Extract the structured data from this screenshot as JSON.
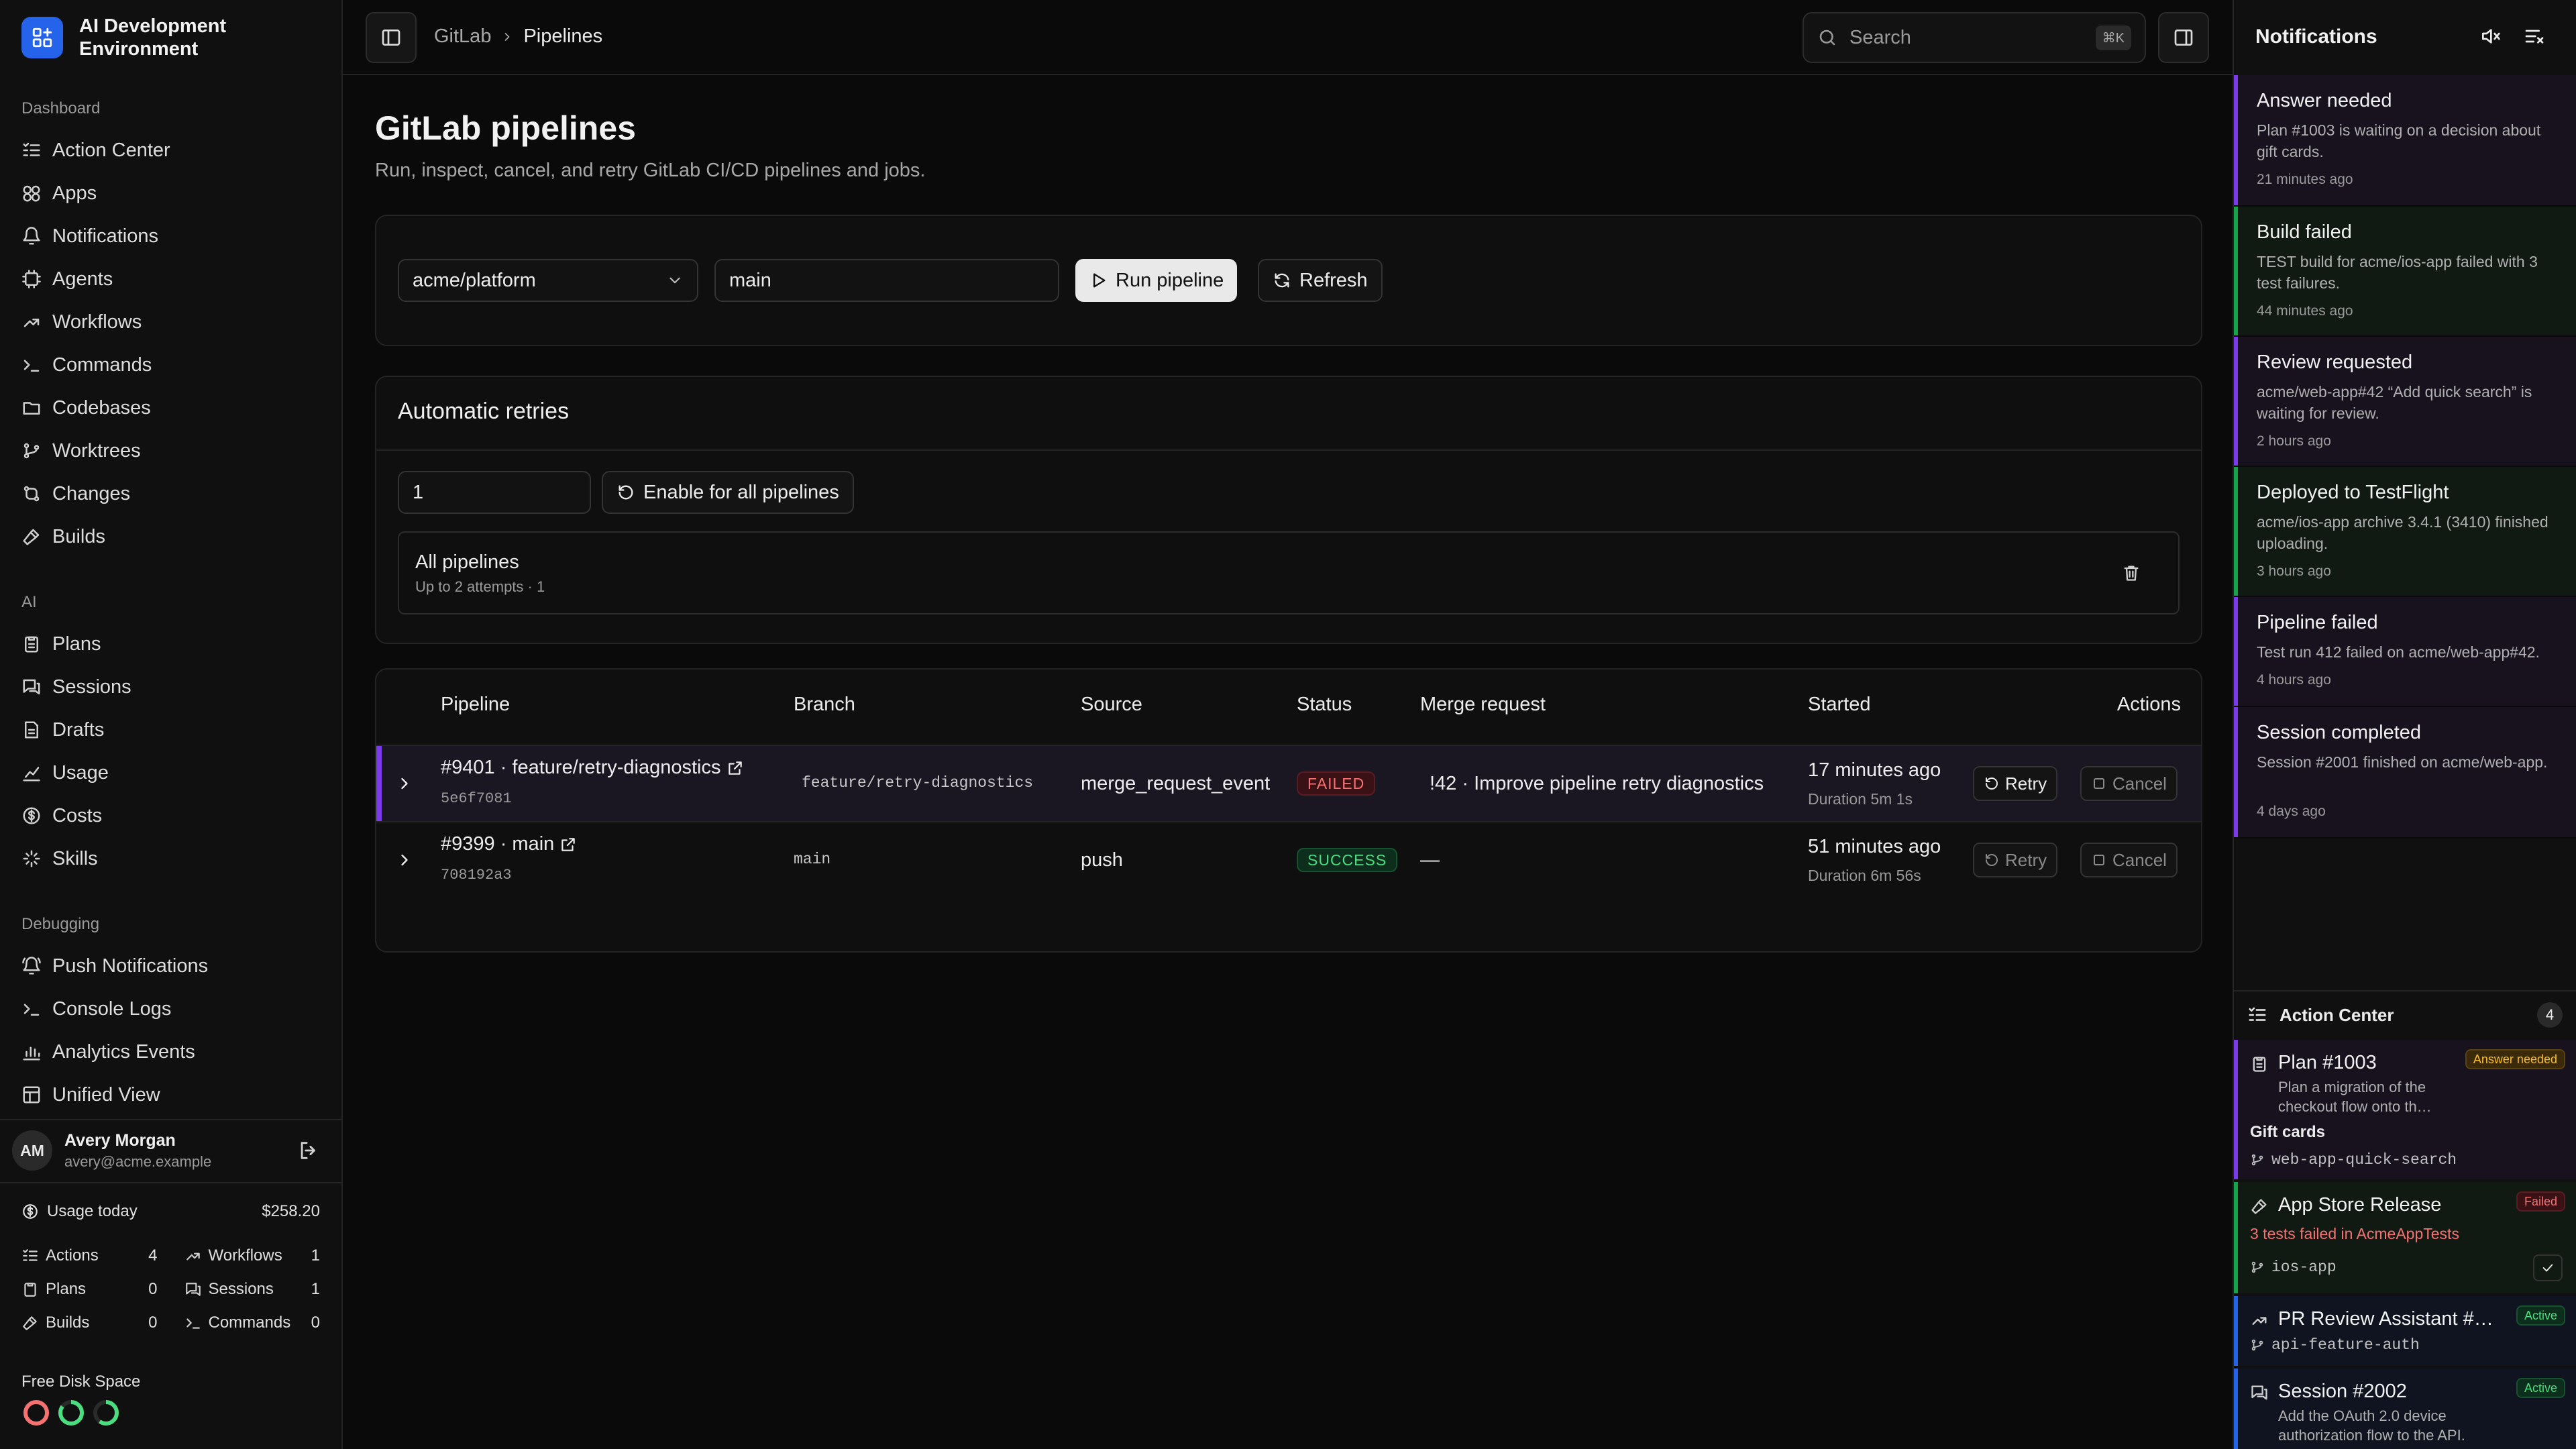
{
  "app": {
    "name": "AI Development Environment"
  },
  "sidebar": {
    "sections": [
      {
        "label": "Dashboard",
        "items": [
          {
            "label": "Action Center",
            "icon": "list-check-icon"
          },
          {
            "label": "Apps",
            "icon": "apps-icon"
          },
          {
            "label": "Notifications",
            "icon": "bell-icon"
          },
          {
            "label": "Agents",
            "icon": "agent-icon"
          },
          {
            "label": "Workflows",
            "icon": "workflow-icon"
          },
          {
            "label": "Commands",
            "icon": "terminal-icon"
          },
          {
            "label": "Codebases",
            "icon": "folder-icon"
          },
          {
            "label": "Worktrees",
            "icon": "git-branch-icon"
          },
          {
            "label": "Changes",
            "icon": "git-compare-icon"
          },
          {
            "label": "Builds",
            "icon": "hammer-icon"
          }
        ]
      },
      {
        "label": "AI",
        "items": [
          {
            "label": "Plans",
            "icon": "clipboard-icon"
          },
          {
            "label": "Sessions",
            "icon": "chat-icon"
          },
          {
            "label": "Drafts",
            "icon": "draft-icon"
          },
          {
            "label": "Usage",
            "icon": "chart-icon"
          },
          {
            "label": "Costs",
            "icon": "dollar-icon"
          },
          {
            "label": "Skills",
            "icon": "sparkle-icon"
          }
        ]
      },
      {
        "label": "Debugging",
        "items": [
          {
            "label": "Push Notifications",
            "icon": "bell-ring-icon"
          },
          {
            "label": "Console Logs",
            "icon": "terminal-icon"
          },
          {
            "label": "Analytics Events",
            "icon": "activity-icon"
          },
          {
            "label": "Unified View",
            "icon": "layout-icon"
          }
        ]
      }
    ],
    "user": {
      "initials": "AM",
      "name": "Avery Morgan",
      "email": "avery@acme.example"
    },
    "usage": {
      "label": "Usage today",
      "value": "$258.20",
      "stats": [
        {
          "label": "Actions",
          "value": "4",
          "icon": "list-check-icon"
        },
        {
          "label": "Workflows",
          "value": "1",
          "icon": "workflow-icon"
        },
        {
          "label": "Plans",
          "value": "0",
          "icon": "clipboard-icon"
        },
        {
          "label": "Sessions",
          "value": "1",
          "icon": "chat-icon"
        },
        {
          "label": "Builds",
          "value": "0",
          "icon": "hammer-icon"
        },
        {
          "label": "Commands",
          "value": "0",
          "icon": "terminal-icon"
        }
      ]
    },
    "disk": {
      "label": "Free Disk Space",
      "rings": [
        {
          "color": "#f87171",
          "fraction": 1.0
        },
        {
          "color": "#4ade80",
          "fraction": 0.85
        },
        {
          "color": "#4ade80",
          "fraction": 0.6
        }
      ]
    }
  },
  "topbar": {
    "breadcrumb": [
      "GitLab",
      "Pipelines"
    ],
    "search": {
      "placeholder": "Search",
      "shortcut": "⌘K"
    }
  },
  "page": {
    "title": "GitLab pipelines",
    "subtitle": "Run, inspect, cancel, and retry GitLab CI/CD pipelines and jobs.",
    "run": {
      "project": "acme/platform",
      "ref": "main",
      "run_label": "Run pipeline",
      "refresh_label": "Refresh"
    },
    "retries": {
      "title": "Automatic retries",
      "attempts_value": "1",
      "enable_label": "Enable for all pipelines",
      "rule": {
        "title": "All pipelines",
        "detail": "Up to 2 attempts · 1"
      }
    },
    "table": {
      "columns": [
        "Pipeline",
        "Branch",
        "Source",
        "Status",
        "Merge request",
        "Started",
        "Actions"
      ],
      "rows": [
        {
          "pipeline": "#9401 · feature/retry-diagnostics",
          "sha": "5e6f7081",
          "branch": "feature/retry-diagnostics",
          "source": "merge_request_event",
          "status": "FAILED",
          "mr": "!42 · Improve pipeline retry diagnostics",
          "started": "17 minutes ago",
          "duration": "Duration 5m 1s",
          "retry": "Retry",
          "cancel": "Cancel"
        },
        {
          "pipeline": "#9399 · main",
          "sha": "708192a3",
          "branch": "main",
          "source": "push",
          "status": "SUCCESS",
          "mr": "—",
          "started": "51 minutes ago",
          "duration": "Duration 6m 56s",
          "retry": "Retry",
          "cancel": "Cancel"
        }
      ]
    }
  },
  "notifications": {
    "title": "Notifications",
    "items": [
      {
        "title": "Answer needed",
        "desc": "Plan #1003 is waiting on a decision about gift cards.",
        "time": "21 minutes ago",
        "color": "#7c3aed"
      },
      {
        "title": "Build failed",
        "desc": "TEST build for acme/ios-app failed with 3 test failures.",
        "time": "44 minutes ago",
        "color": "#16a34a"
      },
      {
        "title": "Review requested",
        "desc": "acme/web-app#42 “Add quick search” is waiting for review.",
        "time": "2 hours ago",
        "color": "#7c3aed"
      },
      {
        "title": "Deployed to TestFlight",
        "desc": "acme/ios-app archive 3.4.1 (3410) finished uploading.",
        "time": "3 hours ago",
        "color": "#16a34a"
      },
      {
        "title": "Pipeline failed",
        "desc": "Test run 412 failed on acme/web-app#42.",
        "time": "4 hours ago",
        "color": "#7c3aed"
      },
      {
        "title": "Session completed",
        "desc": "Session #2001 finished on acme/web-app.",
        "time": "4 days ago",
        "color": "#7c3aed"
      }
    ]
  },
  "action_center": {
    "title": "Action Center",
    "count": "4",
    "items": [
      {
        "title": "Plan #1003",
        "tag": "Answer needed",
        "desc": "Plan a migration of the checkout flow onto th…",
        "extra": "Gift cards",
        "branch": "web-app-quick-search",
        "color": "#7c3aed"
      },
      {
        "title": "App Store Release",
        "tag": "Failed",
        "desc": "3 tests failed in AcmeAppTests",
        "branch": "ios-app",
        "color": "#16a34a"
      },
      {
        "title": "PR Review Assistant #4…",
        "tag": "Active",
        "branch": "api-feature-auth",
        "color": "#2563eb"
      },
      {
        "title": "Session #2002",
        "tag": "Active",
        "desc": "Add the OAuth 2.0 device authorization flow to the API.",
        "color": "#2563eb"
      }
    ]
  }
}
